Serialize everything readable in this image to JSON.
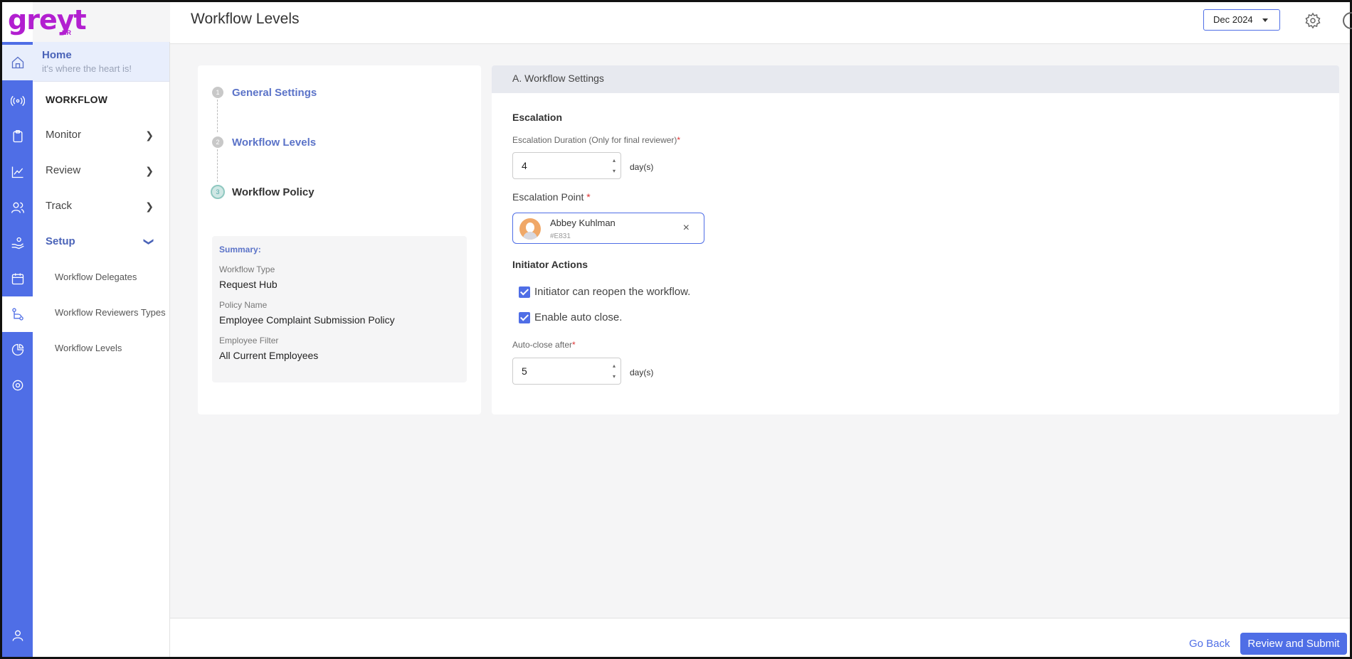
{
  "logo": {
    "text": "greyt",
    "suffix": "HR"
  },
  "header": {
    "title": "Workflow Levels",
    "month": "Dec 2024"
  },
  "rail": {
    "icons": [
      "home-icon",
      "broadcast-icon",
      "clipboard-icon",
      "chart-icon",
      "users-icon",
      "hand-coin-icon",
      "calendar-icon",
      "workflow-icon",
      "pie-chart-icon",
      "settings-icon",
      "profile-icon"
    ]
  },
  "nav": {
    "home_title": "Home",
    "home_tagline": "it's where the heart is!",
    "section": "WORKFLOW",
    "items": [
      {
        "label": "Monitor"
      },
      {
        "label": "Review"
      },
      {
        "label": "Track"
      },
      {
        "label": "Setup"
      }
    ],
    "subitems": [
      {
        "label": "Workflow Delegates"
      },
      {
        "label": "Workflow Reviewers Types"
      },
      {
        "label": "Workflow Levels"
      }
    ]
  },
  "steps": [
    {
      "num": "1",
      "label": "General Settings"
    },
    {
      "num": "2",
      "label": "Workflow Levels"
    },
    {
      "num": "3",
      "label": "Workflow Policy"
    }
  ],
  "summary": {
    "title": "Summary:",
    "workflow_type_label": "Workflow Type",
    "workflow_type": "Request Hub",
    "policy_name_label": "Policy Name",
    "policy_name": "Employee Complaint Submission Policy",
    "employee_filter_label": "Employee Filter",
    "employee_filter": "All Current Employees"
  },
  "settings": {
    "heading": "A. Workflow Settings",
    "escalation_title": "Escalation",
    "escalation_duration_label": "Escalation Duration (Only for final reviewer)",
    "escalation_duration_value": "4",
    "unit": "day(s)",
    "escalation_point_label": "Escalation Point ",
    "required_mark": "*",
    "person_name": "Abbey Kuhlman",
    "person_id": "#E831",
    "remove_glyph": "×",
    "initiator_title": "Initiator Actions",
    "reopen_label": "Initiator can reopen the workflow.",
    "autoclose_label": "Enable auto close.",
    "autoclose_after_label": "Auto-close after",
    "autoclose_after_value": "5"
  },
  "footer": {
    "go_back": "Go Back",
    "submit": "Review and Submit"
  },
  "colors": {
    "accent": "#4f6ee6",
    "brand": "#b21fd0"
  }
}
